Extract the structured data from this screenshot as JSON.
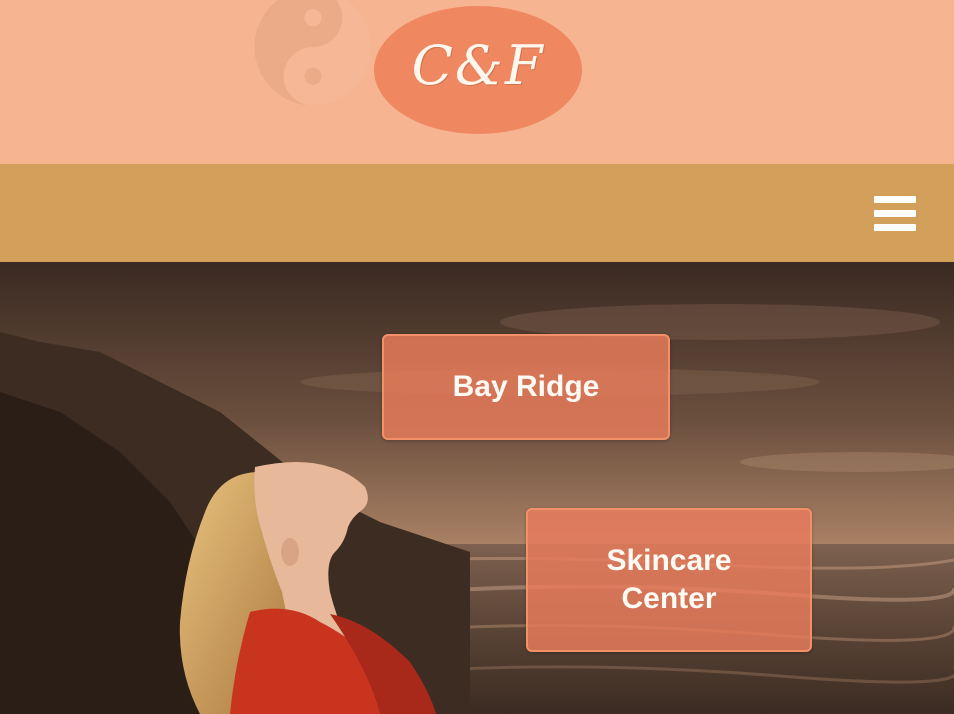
{
  "header": {
    "logo_text": "C&F",
    "emblem_icon": "yin-yang-icon"
  },
  "nav": {
    "menu_icon": "hamburger-menu-icon"
  },
  "hero": {
    "buttons": [
      {
        "label": "Bay Ridge"
      },
      {
        "label": "Skincare Center"
      }
    ]
  },
  "colors": {
    "header_bg": "#f6b491",
    "logo_bg": "#ef8860",
    "nav_bg": "#d3a05c",
    "button_bg": "#ea7c5c",
    "button_border": "#f2906a"
  }
}
